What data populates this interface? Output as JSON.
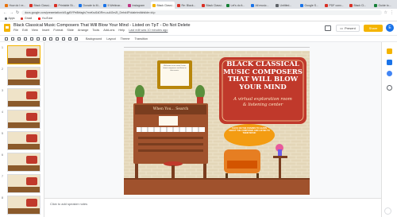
{
  "browser": {
    "tabs": [
      {
        "label": "How do I re...",
        "color": "#e8710a"
      },
      {
        "label": "Black Classi...",
        "color": "#d93025"
      },
      {
        "label": "Printable St...",
        "color": "#d93025"
      },
      {
        "label": "Donate to M...",
        "color": "#1a73e8"
      },
      {
        "label": "5 Webinar...",
        "color": "#1a73e8"
      },
      {
        "label": "Instagram",
        "color": "#c13584"
      },
      {
        "label": "Black Classi...",
        "color": "#f4b400",
        "active": true
      },
      {
        "label": "Re: Black...",
        "color": "#d93025"
      },
      {
        "label": "Black Classi...",
        "color": "#d93025"
      },
      {
        "label": "Let's do it...",
        "color": "#188038"
      },
      {
        "label": "All music...",
        "color": "#1a73e8"
      },
      {
        "label": "Untitled...",
        "color": "#5f6368"
      },
      {
        "label": "Google S...",
        "color": "#1a73e8"
      },
      {
        "label": "PDF conv...",
        "color": "#d93025"
      },
      {
        "label": "Black Cl...",
        "color": "#d93025"
      },
      {
        "label": "Guide to...",
        "color": "#188038"
      }
    ],
    "url": "docs.google.com/presentation/d/1gyBYPe8bfagIs7mnKsd1kDRm-uuAGmZt_Drrbd4Pddale/edit#slide=id.p",
    "bookmarks": [
      {
        "label": "Apps",
        "color": "#5f6368"
      },
      {
        "label": "Gmail",
        "color": "#d93025"
      },
      {
        "label": "YouTube",
        "color": "#ff0000"
      }
    ]
  },
  "doc": {
    "title": "Black Classical Music Composers That Will Blow Your Mind - Listed on TpT - Do Not Delete",
    "menu": [
      "File",
      "Edit",
      "View",
      "Insert",
      "Format",
      "Slide",
      "Arrange",
      "Tools",
      "Add-ons",
      "Help",
      "Last edit was 10 minutes ago"
    ],
    "present_label": "Present",
    "share_label": "Share",
    "avatar_initial": "E"
  },
  "toolbar": {
    "items": [
      "Background",
      "Layout",
      "Theme",
      "Transition"
    ]
  },
  "filmstrip": {
    "slides": [
      "1",
      "2",
      "3",
      "4",
      "5",
      "6",
      "7",
      "8"
    ]
  },
  "slide": {
    "title_line1": "BLACK CLASSICAL",
    "title_line2": "MUSIC COMPOSERS",
    "title_line3": "THAT WILL BLOW",
    "title_line4": "YOUR MIND",
    "subtitle_line1": "A virtual exploration room",
    "subtitle_line2": "& listening center",
    "piano_sign": "When You... Search",
    "frame_text": "Welcome to our room! Learn about composers and listen to their music.",
    "bubble_text": "CLICK ON THE FRAMES TO LEARN ABOUT THE COMPOSER AND LISTEN TO THEIR MUSIC"
  },
  "notes": {
    "placeholder": "Click to add speaker notes"
  },
  "colors": {
    "accent": "#f4b400",
    "banner": "#c0392b",
    "wall": "#ece2c9",
    "piano": "#a0522d"
  }
}
